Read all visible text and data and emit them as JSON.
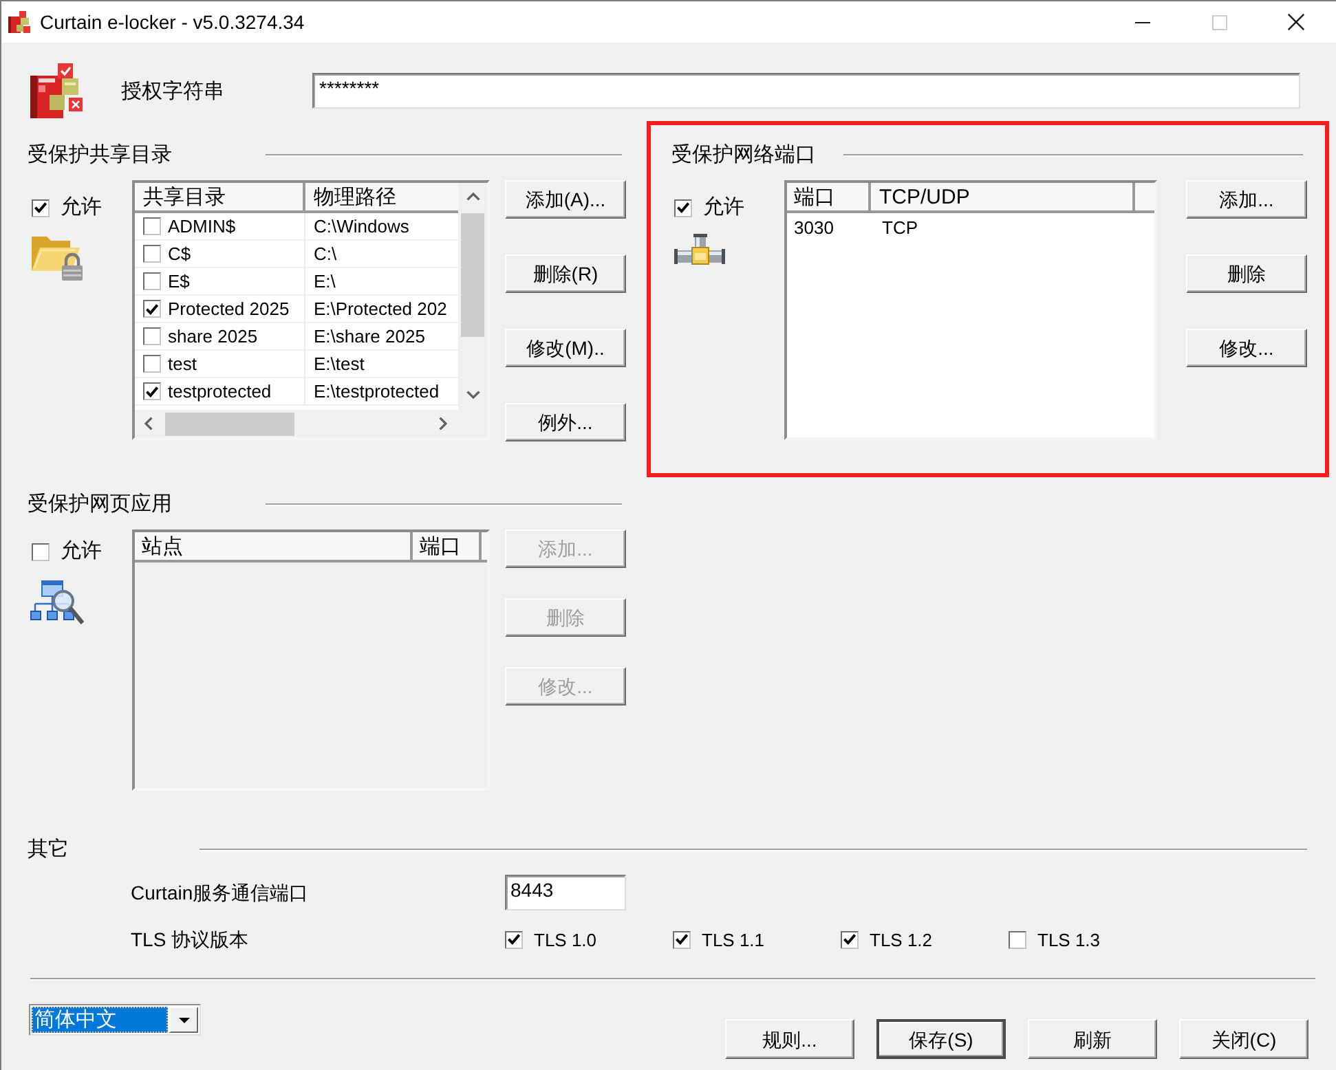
{
  "window": {
    "title": "Curtain e-locker - v5.0.3274.34",
    "controls": [
      {
        "kind": "minimize",
        "disabled": false
      },
      {
        "kind": "maximize",
        "disabled": true
      },
      {
        "kind": "close",
        "disabled": false
      }
    ]
  },
  "license": {
    "label": "授权字符串",
    "value": "********"
  },
  "shared_folders": {
    "title": "受保护共享目录",
    "allow": {
      "label": "允许",
      "checked": true
    },
    "table": {
      "columns": [
        "共享目录",
        "物理路径"
      ],
      "rows": [
        {
          "checked": false,
          "cells": [
            "ADMIN$",
            "C:\\Windows"
          ]
        },
        {
          "checked": false,
          "cells": [
            "C$",
            "C:\\"
          ]
        },
        {
          "checked": false,
          "cells": [
            "E$",
            "E:\\"
          ]
        },
        {
          "checked": true,
          "cells": [
            "Protected 2025",
            "E:\\Protected 202"
          ]
        },
        {
          "checked": false,
          "cells": [
            "share 2025",
            "E:\\share 2025"
          ]
        },
        {
          "checked": false,
          "cells": [
            "test",
            "E:\\test"
          ]
        },
        {
          "checked": true,
          "cells": [
            "testprotected",
            "E:\\testprotected"
          ]
        }
      ]
    },
    "buttons": [
      {
        "label": "添加(A)..."
      },
      {
        "label": "删除(R)"
      },
      {
        "label": "修改(M).."
      },
      {
        "label": "例外..."
      }
    ]
  },
  "network_ports": {
    "title": "受保护网络端口",
    "allow": {
      "label": "允许",
      "checked": true
    },
    "table": {
      "columns": [
        "端口",
        "TCP/UDP"
      ],
      "rows": [
        {
          "cells": [
            "3030",
            "TCP"
          ]
        }
      ]
    },
    "buttons": [
      {
        "label": "添加..."
      },
      {
        "label": "删除"
      },
      {
        "label": "修改..."
      }
    ]
  },
  "web_apps": {
    "title": "受保护网页应用",
    "allow": {
      "label": "允许",
      "checked": false
    },
    "table": {
      "columns": [
        "站点",
        "端口"
      ],
      "disabled": true
    },
    "buttons": [
      {
        "label": "添加...",
        "disabled": true
      },
      {
        "label": "删除",
        "disabled": true
      },
      {
        "label": "修改...",
        "disabled": true
      }
    ]
  },
  "other": {
    "title": "其它",
    "service_port": {
      "label": "Curtain服务通信端口",
      "value": "8443"
    },
    "tls": {
      "label": "TLS 协议版本",
      "options": [
        {
          "label": "TLS 1.0",
          "checked": true
        },
        {
          "label": "TLS 1.1",
          "checked": true
        },
        {
          "label": "TLS 1.2",
          "checked": true
        },
        {
          "label": "TLS 1.3",
          "checked": false
        }
      ]
    }
  },
  "language": {
    "value": "简体中文",
    "focused": true
  },
  "buttons": [
    {
      "label": "规则...",
      "default": false
    },
    {
      "label": "保存(S)",
      "default": true
    },
    {
      "label": "刷新",
      "default": false
    },
    {
      "label": "关闭(C)",
      "default": false
    }
  ]
}
